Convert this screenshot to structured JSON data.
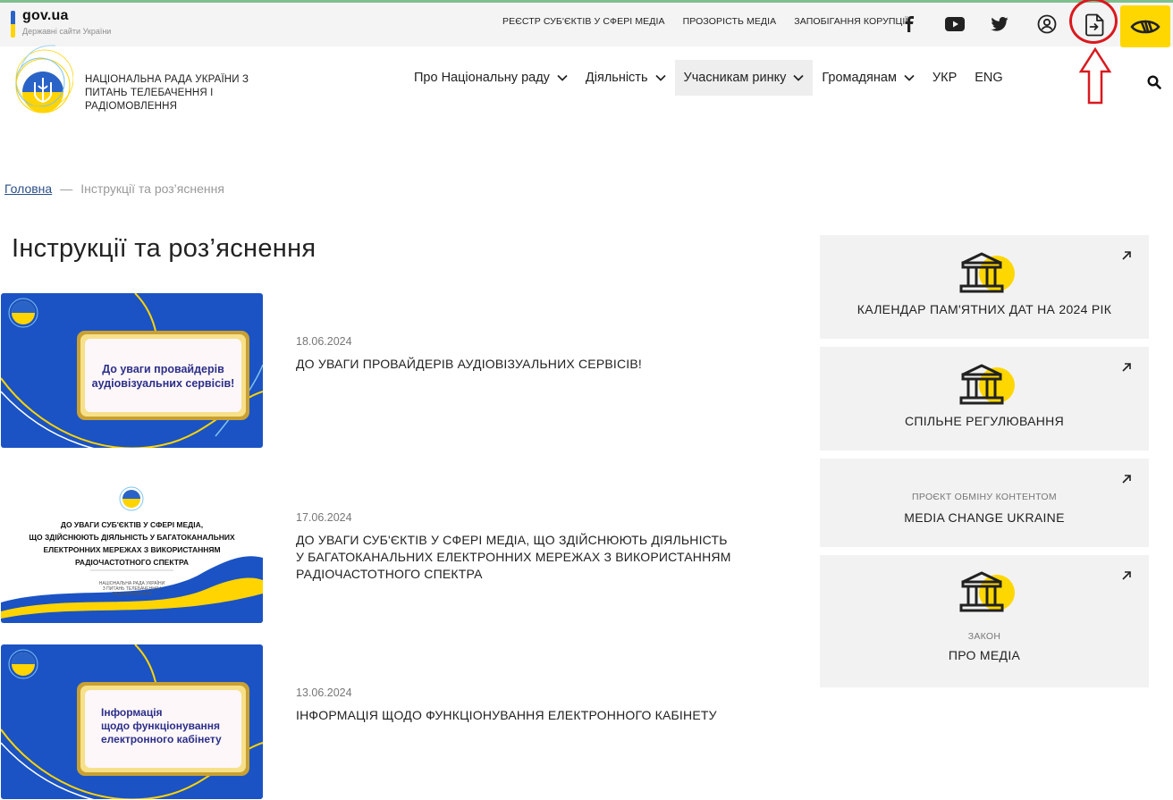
{
  "topbar": {
    "gov_title": "gov.ua",
    "gov_subtitle": "Державні сайти України",
    "links": [
      "РЕЄСТР СУБ'ЄКТІВ У СФЕРІ МЕДІА",
      "ПРОЗОРІСТЬ МЕДІА",
      "ЗАПОБІГАННЯ КОРУПЦІЇ"
    ],
    "social_icons": [
      "facebook-icon",
      "youtube-icon",
      "twitter-icon",
      "user-icon"
    ],
    "cabinet_icon": "login-document-icon",
    "accessibility_icon": "eye-icon",
    "accent_color": "#ffd700",
    "annotation_color": "#d9191e"
  },
  "header": {
    "org_name": "НАЦІОНАЛЬНА РАДА УКРАЇНИ З ПИТАНЬ ТЕЛЕБАЧЕННЯ І РАДІОМОВЛЕННЯ",
    "nav": [
      {
        "label": "Про Національну раду",
        "dropdown": true
      },
      {
        "label": "Діяльність",
        "dropdown": true
      },
      {
        "label": "Учасникам ринку",
        "dropdown": true,
        "active": true
      },
      {
        "label": "Громадянам",
        "dropdown": true
      },
      {
        "label": "УКР",
        "dropdown": false
      },
      {
        "label": "ENG",
        "dropdown": false
      }
    ]
  },
  "breadcrumb": {
    "home": "Головна",
    "separator": "—",
    "current": "Інструкції та роз’яснення"
  },
  "page_title": "Інструкції та роз’яснення",
  "news": [
    {
      "date": "18.06.2024",
      "title": "ДО УВАГИ ПРОВАЙДЕРІВ АУДІОВІЗУАЛЬНИХ СЕРВІСІВ!",
      "image_text": [
        "До уваги провайдерів",
        "аудіовізуальних сервісів!"
      ]
    },
    {
      "date": "17.06.2024",
      "title": "ДО УВАГИ СУБ'ЄКТІВ У СФЕРІ МЕДІА, ЩО ЗДІЙСНЮЮТЬ ДІЯЛЬНІСТЬ У БАГАТОКАНАЛЬНИХ ЕЛЕКТРОННИХ МЕРЕЖАХ З ВИКОРИСТАННЯМ РАДІОЧАСТОТНОГО СПЕКТРА",
      "image_text": [
        "ДО УВАГИ СУБ'ЄКТІВ У СФЕРІ МЕДІА,",
        "ЩО ЗДІЙСНЮЮТЬ ДІЯЛЬНІСТЬ У БАГАТОКАНАЛЬНИХ",
        "ЕЛЕКТРОННИХ МЕРЕЖАХ З ВИКОРИСТАННЯМ",
        "РАДІОЧАСТОТНОГО СПЕКТРА"
      ],
      "image_footer": [
        "НАЦІОНАЛЬНА РАДА УКРАЇНИ",
        "З ПИТАНЬ ТЕЛЕБАЧЕННЯ І",
        "РАДІОМОВЛЕННЯ"
      ]
    },
    {
      "date": "13.06.2024",
      "title": "ІНФОРМАЦІЯ ЩОДО ФУНКЦІОНУВАННЯ ЕЛЕКТРОННОГО КАБІНЕТУ",
      "image_text": [
        "Інформація",
        "щодо функціонування",
        "електронного кабінету"
      ]
    }
  ],
  "sidebar": [
    {
      "small": "",
      "label": "КАЛЕНДАР ПАМ'ЯТНИХ ДАТ НА 2024 РІК",
      "icon": "building-icon"
    },
    {
      "small": "",
      "label": "СПІЛЬНЕ РЕГУЛЮВАННЯ",
      "icon": "building-icon"
    },
    {
      "small": "ПРОЄКТ ОБМІНУ КОНТЕНТОМ",
      "label": "MEDIA CHANGE UKRAINE",
      "icon": ""
    },
    {
      "small": "ЗАКОН",
      "label": "ПРО МЕДІА",
      "icon": "building-icon"
    }
  ]
}
